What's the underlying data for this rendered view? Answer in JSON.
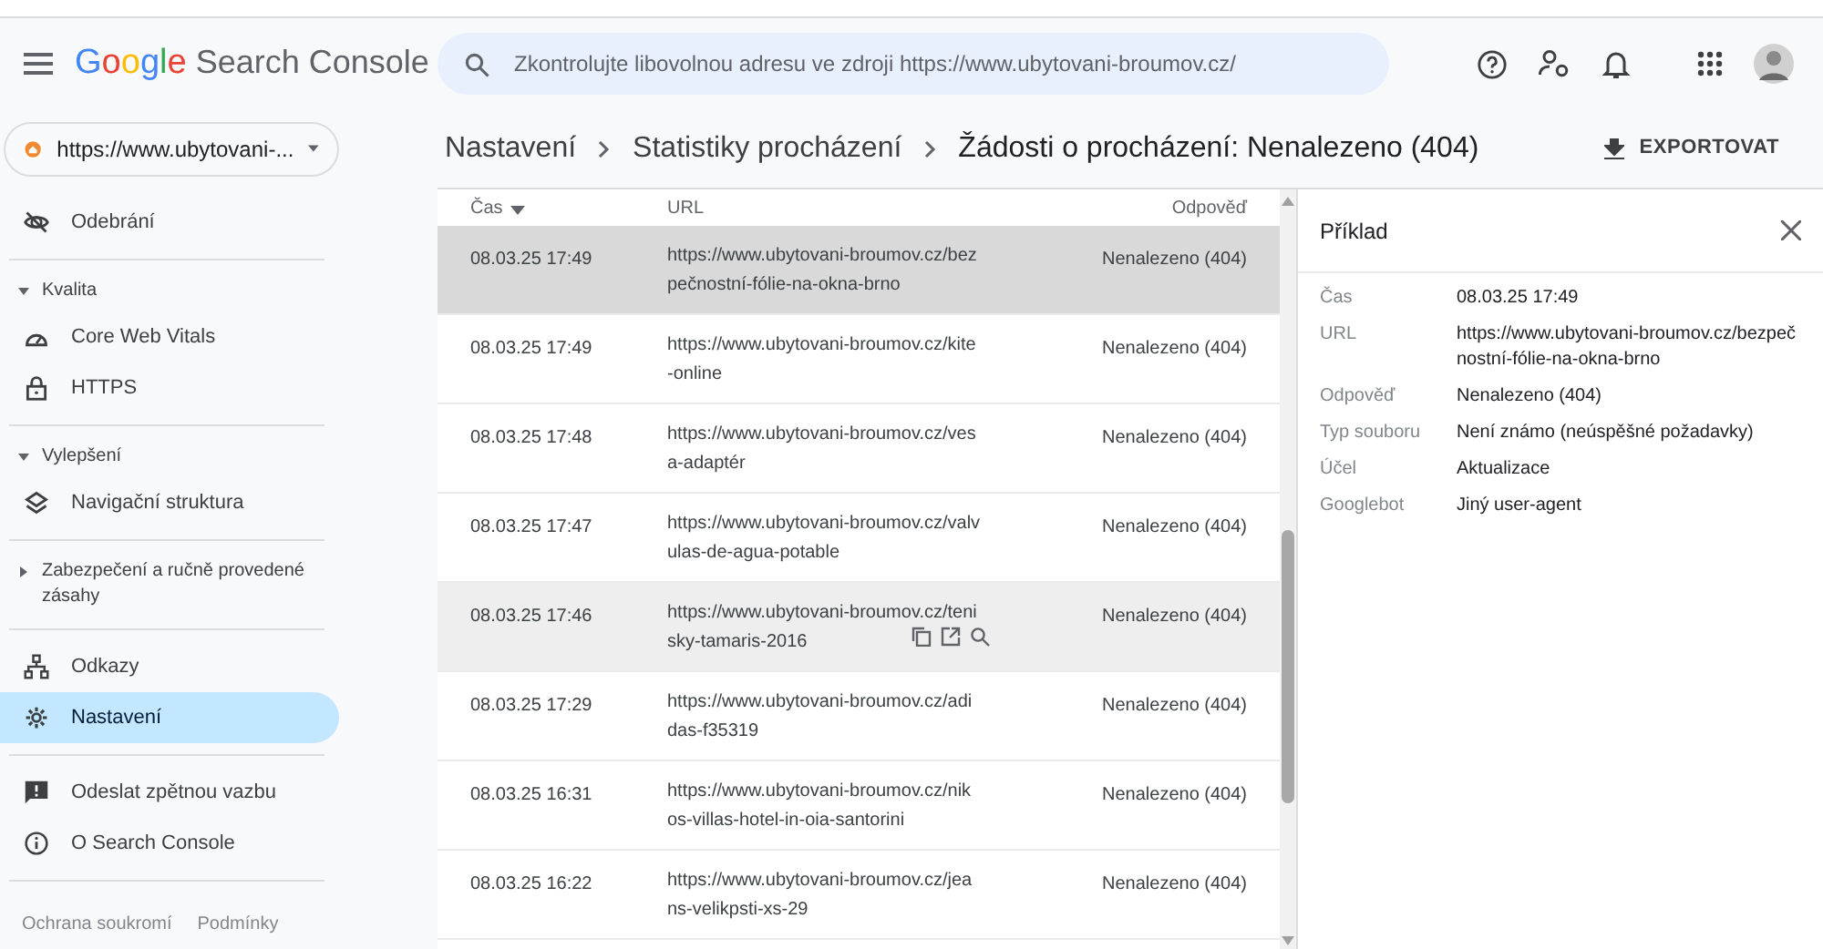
{
  "header": {
    "product": "Search Console",
    "brand": "Google",
    "search": {
      "placeholder": "Zkontrolujte libovolnou adresu ve zdroji https://www.ubytovani-broumov.cz/"
    }
  },
  "property": {
    "label": "https://www.ubytovani-..."
  },
  "breadcrumb": [
    "Nastavení",
    "Statistiky procházení",
    "Žádosti o procházení: Nenalezeno (404)"
  ],
  "export_button": "EXPORTOVAT",
  "sidebar": {
    "items": [
      {
        "kind": "item",
        "label": "Odebrání",
        "selected": false
      },
      {
        "kind": "divider"
      },
      {
        "kind": "section",
        "label": "Kvalita",
        "expanded": true
      },
      {
        "kind": "item",
        "label": "Core Web Vitals",
        "selected": false
      },
      {
        "kind": "item",
        "label": "HTTPS",
        "selected": false
      },
      {
        "kind": "divider"
      },
      {
        "kind": "section",
        "label": "Vylepšení",
        "expanded": true
      },
      {
        "kind": "item",
        "label": "Navigační struktura",
        "selected": false
      },
      {
        "kind": "divider"
      },
      {
        "kind": "section",
        "label": "Zabezpečení a ručně provedené zásahy",
        "expanded": false
      },
      {
        "kind": "divider"
      },
      {
        "kind": "item",
        "label": "Odkazy",
        "selected": false
      },
      {
        "kind": "item",
        "label": "Nastavení",
        "selected": true
      },
      {
        "kind": "divider"
      },
      {
        "kind": "item",
        "label": "Odeslat zpětnou vazbu",
        "selected": false
      },
      {
        "kind": "item",
        "label": "O Search Console",
        "selected": false
      },
      {
        "kind": "divider"
      }
    ],
    "footer_links": [
      "Ochrana soukromí",
      "Podmínky"
    ]
  },
  "table": {
    "columns": [
      "Čas",
      "URL",
      "Odpověď"
    ],
    "rows": [
      {
        "time": "08.03.25 17:49",
        "url": "https://www.ubytovani-broumov.cz/bezpečnostní-fólie-na-okna-brno",
        "response": "Nenalezeno (404)",
        "selected": true,
        "hovered": false
      },
      {
        "time": "08.03.25 17:49",
        "url": "https://www.ubytovani-broumov.cz/kite-online",
        "response": "Nenalezeno (404)",
        "selected": false,
        "hovered": false
      },
      {
        "time": "08.03.25 17:48",
        "url": "https://www.ubytovani-broumov.cz/vesa-adaptér",
        "response": "Nenalezeno (404)",
        "selected": false,
        "hovered": false
      },
      {
        "time": "08.03.25 17:47",
        "url": "https://www.ubytovani-broumov.cz/valvulas-de-agua-potable",
        "response": "Nenalezeno (404)",
        "selected": false,
        "hovered": false
      },
      {
        "time": "08.03.25 17:46",
        "url": "https://www.ubytovani-broumov.cz/tenisky-tamaris-2016",
        "response": "Nenalezeno (404)",
        "selected": false,
        "hovered": true
      },
      {
        "time": "08.03.25 17:29",
        "url": "https://www.ubytovani-broumov.cz/adidas-f35319",
        "response": "Nenalezeno (404)",
        "selected": false,
        "hovered": false
      },
      {
        "time": "08.03.25 16:31",
        "url": "https://www.ubytovani-broumov.cz/nikos-villas-hotel-in-oia-santorini",
        "response": "Nenalezeno (404)",
        "selected": false,
        "hovered": false
      },
      {
        "time": "08.03.25 16:22",
        "url": "https://www.ubytovani-broumov.cz/jeans-velikpsti-xs-29",
        "response": "Nenalezeno (404)",
        "selected": false,
        "hovered": false
      }
    ]
  },
  "detail": {
    "title": "Příklad",
    "fields": [
      {
        "label": "Čas",
        "value": "08.03.25 17:49"
      },
      {
        "label": "URL",
        "value": "https://www.ubytovani-broumov.cz/bezpečnostní-fólie-na-okna-brno"
      },
      {
        "label": "Odpověď",
        "value": "Nenalezeno (404)"
      },
      {
        "label": "Typ souboru",
        "value": "Není známo (neúspěšné požadavky)"
      },
      {
        "label": "Účel",
        "value": "Aktualizace"
      },
      {
        "label": "Googlebot",
        "value": "Jiný user-agent"
      }
    ]
  }
}
